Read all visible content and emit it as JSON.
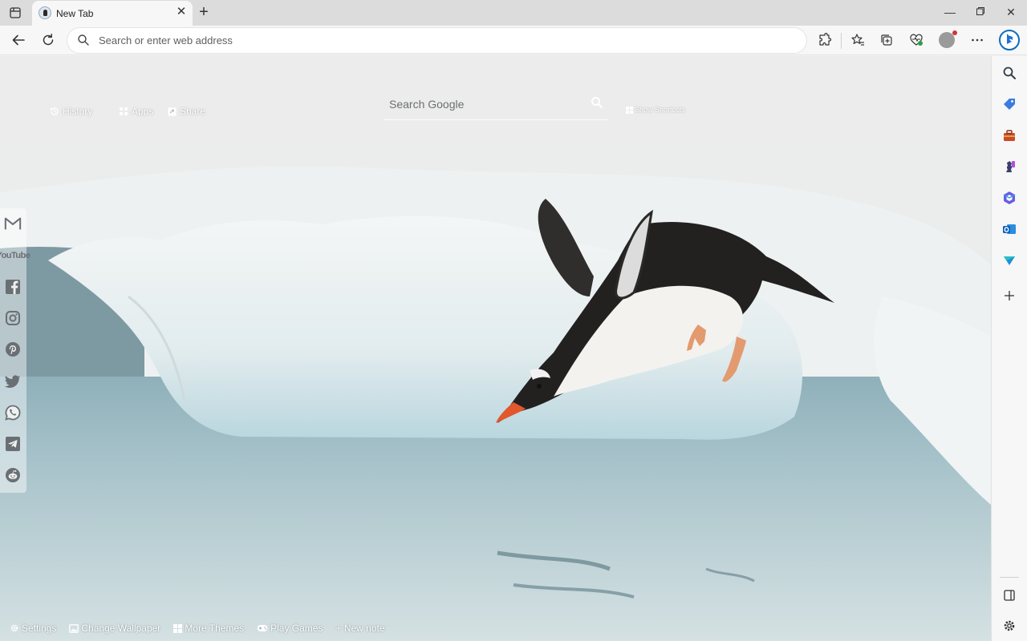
{
  "browser": {
    "tab": {
      "title": "New Tab"
    },
    "address_bar": {
      "placeholder": "Search or enter web address"
    },
    "icons": [
      "tab-actions-icon",
      "close-icon",
      "plus-icon",
      "minimize-icon",
      "maximize-icon",
      "window-close-icon",
      "back-icon",
      "refresh-icon",
      "search-icon",
      "extensions-icon",
      "favorites-icon",
      "collections-icon",
      "browser-essentials-icon",
      "profile-avatar",
      "more-icon",
      "copilot-icon"
    ],
    "colors": {
      "accent": "#0f6cbd",
      "notification": "#d13438"
    }
  },
  "sidebar": {
    "items": [
      "search-icon",
      "shopping-tag-icon",
      "tools-icon",
      "games-icon",
      "microsoft365-icon",
      "outlook-icon",
      "drop-icon",
      "add-icon"
    ],
    "bottom": [
      "split-screen-icon",
      "settings-icon"
    ]
  },
  "newtab": {
    "top_links": {
      "history": "History",
      "apps": "Apps",
      "share": "Share"
    },
    "search": {
      "placeholder": "Search Google"
    },
    "show_shortcuts": "Show Shortcuts",
    "social": [
      "gmail-icon",
      "youtube-icon",
      "facebook-icon",
      "instagram-icon",
      "pinterest-icon",
      "twitter-icon",
      "whatsapp-icon",
      "telegram-icon",
      "reddit-icon"
    ],
    "youtube_label": "YouTube",
    "bottom_bar": {
      "settings": "Settings",
      "change_wallpaper": "Change Wallpaper",
      "more_themes": "More Themes",
      "play_games": "Play Games",
      "new_note": "+ New note"
    }
  }
}
